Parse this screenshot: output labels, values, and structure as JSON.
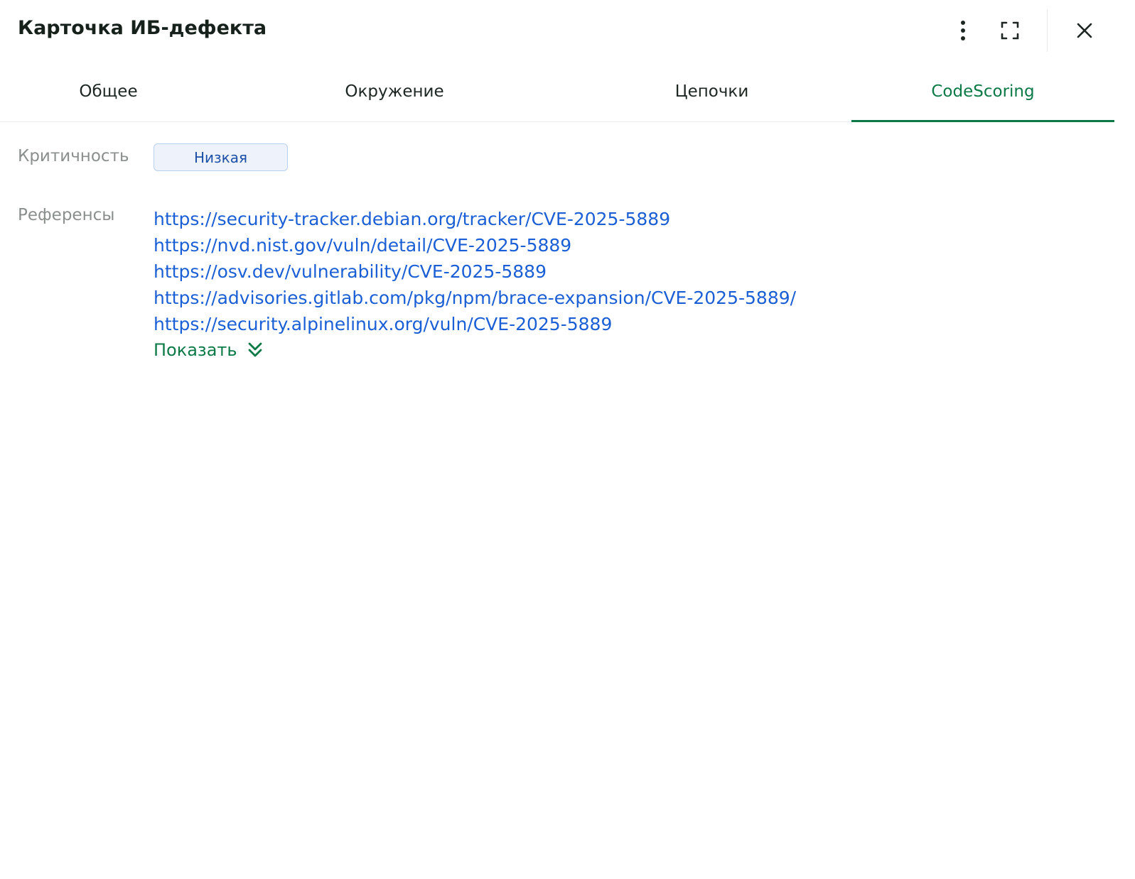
{
  "header": {
    "title": "Карточка ИБ-дефекта"
  },
  "tabs": [
    {
      "label": "Общее",
      "active": false
    },
    {
      "label": "Окружение",
      "active": false
    },
    {
      "label": "Цепочки",
      "active": false
    },
    {
      "label": "CodeScoring",
      "active": true
    }
  ],
  "fields": {
    "criticality_label": "Критичность",
    "criticality_value": "Низкая",
    "references_label": "Референсы",
    "references": [
      "https://security-tracker.debian.org/tracker/CVE-2025-5889",
      "https://nvd.nist.gov/vuln/detail/CVE-2025-5889",
      "https://osv.dev/vulnerability/CVE-2025-5889",
      "https://advisories.gitlab.com/pkg/npm/brace-expansion/CVE-2025-5889/",
      "https://security.alpinelinux.org/vuln/CVE-2025-5889"
    ],
    "show_more_label": "Показать"
  },
  "icons": {
    "more": "more-vertical-icon",
    "expand": "fullscreen-icon",
    "close": "close-icon",
    "show_more": "chevrons-down-icon"
  },
  "colors": {
    "accent": "#0b7a47",
    "link": "#1a5fd6",
    "badge_bg": "#eef3fb",
    "badge_border": "#b8cff0",
    "label": "#8a8f8c"
  }
}
